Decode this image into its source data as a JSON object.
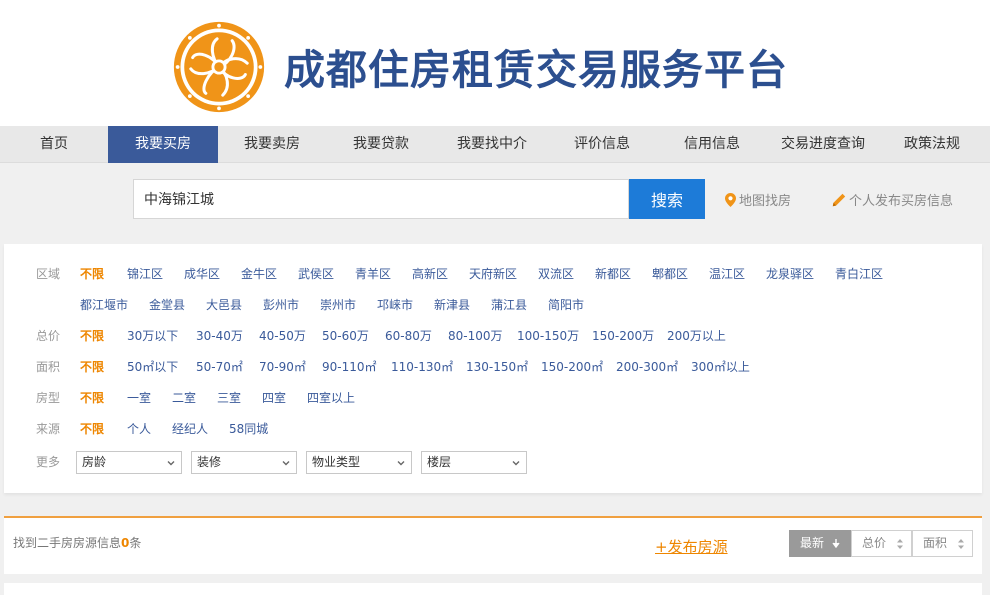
{
  "header": {
    "title": "成都住房租赁交易服务平台"
  },
  "nav": {
    "items": [
      {
        "label": "首页",
        "active": false
      },
      {
        "label": "我要买房",
        "active": true
      },
      {
        "label": "我要卖房",
        "active": false
      },
      {
        "label": "我要贷款",
        "active": false
      },
      {
        "label": "我要找中介",
        "active": false
      },
      {
        "label": "评价信息",
        "active": false
      },
      {
        "label": "信用信息",
        "active": false
      },
      {
        "label": "交易进度查询",
        "active": false
      },
      {
        "label": "政策法规",
        "active": false
      }
    ]
  },
  "search": {
    "value": "中海锦江城",
    "button_label": "搜索",
    "map_link": "地图找房",
    "publish_link": "个人发布买房信息"
  },
  "filters": {
    "region": {
      "label": "区域",
      "options": [
        "不限",
        "锦江区",
        "成华区",
        "金牛区",
        "武侯区",
        "青羊区",
        "高新区",
        "天府新区",
        "双流区",
        "新都区",
        "郫都区",
        "温江区",
        "龙泉驿区",
        "青白江区"
      ],
      "options_row2": [
        "都江堰市",
        "金堂县",
        "大邑县",
        "彭州市",
        "崇州市",
        "邛崃市",
        "新津县",
        "蒲江县",
        "简阳市"
      ]
    },
    "price": {
      "label": "总价",
      "options": [
        "不限",
        "30万以下",
        "30-40万",
        "40-50万",
        "50-60万",
        "60-80万",
        "80-100万",
        "100-150万",
        "150-200万",
        "200万以上"
      ]
    },
    "area": {
      "label": "面积",
      "options": [
        "不限",
        "50㎡以下",
        "50-70㎡",
        "70-90㎡",
        "90-110㎡",
        "110-130㎡",
        "130-150㎡",
        "150-200㎡",
        "200-300㎡",
        "300㎡以上"
      ]
    },
    "rooms": {
      "label": "房型",
      "options": [
        "不限",
        "一室",
        "二室",
        "三室",
        "四室",
        "四室以上"
      ]
    },
    "source": {
      "label": "来源",
      "options": [
        "不限",
        "个人",
        "经纪人",
        "58同城"
      ]
    },
    "more": {
      "label": "更多",
      "selects": [
        "房龄",
        "装修",
        "物业类型",
        "楼层"
      ]
    }
  },
  "results": {
    "found_prefix": "找到二手房房源信息",
    "count": "0",
    "found_suffix": "条",
    "post_link": "+发布房源",
    "sort": [
      {
        "label": "最新",
        "active": true
      },
      {
        "label": "总价",
        "active": false
      },
      {
        "label": "面积",
        "active": false
      }
    ]
  },
  "colors": {
    "brand_blue": "#2c4f8f",
    "nav_active": "#3a5a9a",
    "search_button": "#1d7bd8",
    "accent_orange": "#ee8600",
    "link_blue": "#3a5a9a"
  },
  "icons": {
    "logo": "orange-swirl-emblem",
    "map": "location-pin-icon",
    "publish": "pencil-icon",
    "sort_newest": "down-arrow-icon",
    "sort_other": "up-down-arrows-icon",
    "select": "chevron-down-icon"
  }
}
